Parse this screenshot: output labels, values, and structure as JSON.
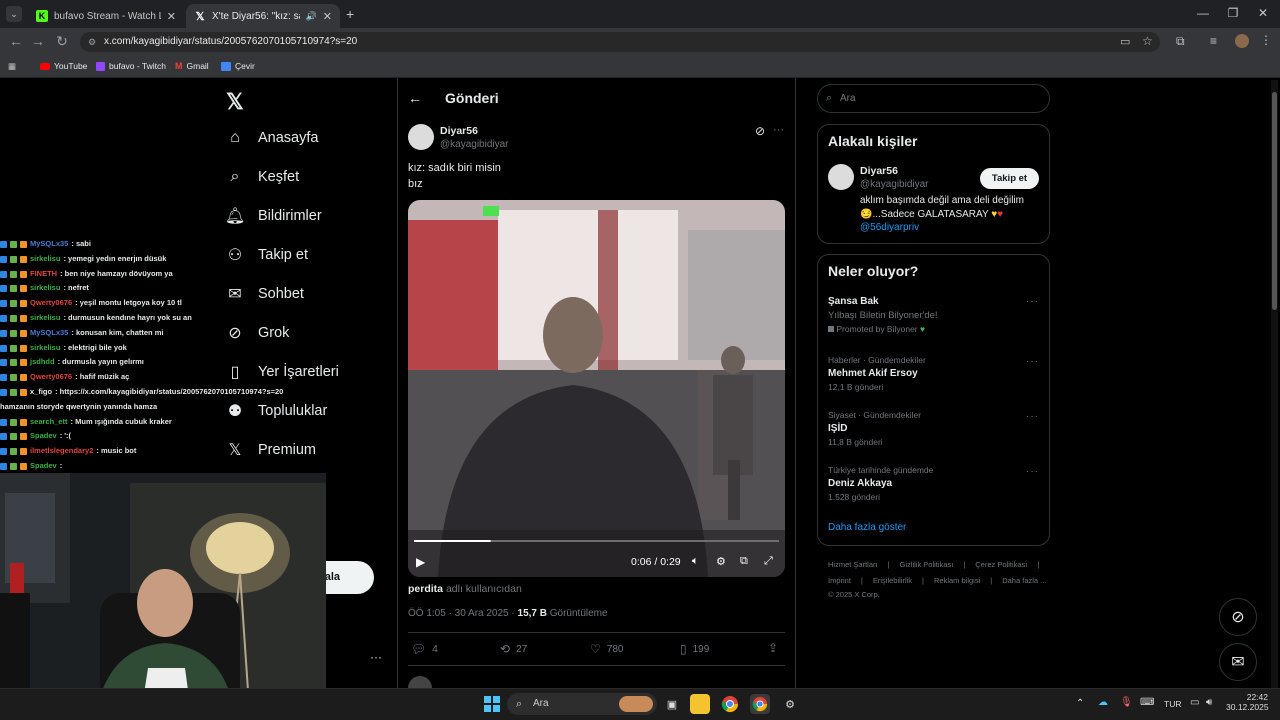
{
  "tabs": [
    {
      "title": "bufavo Stream - Watch Live on",
      "favicon": "kick-icon"
    },
    {
      "title": "X'te Diyar56: \"kız: sadık biri",
      "favicon": "x-icon"
    }
  ],
  "address": {
    "url": "x.com/kayagibidiyar/status/2005762070105710974?s=20"
  },
  "bookmarks": [
    {
      "label": "YouTube"
    },
    {
      "label": "bufavo - Twitch"
    },
    {
      "label": "Gmail"
    },
    {
      "label": "Çevir"
    }
  ],
  "nav": {
    "items": [
      {
        "label": "Anasayfa"
      },
      {
        "label": "Keşfet"
      },
      {
        "label": "Bildirimler"
      },
      {
        "label": "Takip et"
      },
      {
        "label": "Sohbet"
      },
      {
        "label": "Grok"
      },
      {
        "label": "Yer İşaretleri"
      },
      {
        "label": "Topluluklar"
      },
      {
        "label": "Premium"
      }
    ],
    "post_button_partial": "ala",
    "more": "···"
  },
  "post": {
    "header": "Gönderi",
    "author_name": "Diyar56",
    "author_handle": "@kayagibidiyar",
    "text_line1": "kız: sadık biri misin",
    "text_line2": "bız",
    "video_time": "0:06 / 0:29",
    "video_progress": 0.21,
    "caption_user": "perdita",
    "caption_suffix": "adlı kullanıcıdan",
    "time": "ÖÖ 1:05 · 30 Ara 2025 ·",
    "views_count": "15,7 B",
    "views_label": "Görüntüleme",
    "replies": "4",
    "reposts": "27",
    "likes": "780",
    "bookmarks": "199"
  },
  "chat": [
    {
      "user": "MySQLx35",
      "msg": ": sabi",
      "color": "#4a7bd1"
    },
    {
      "user": "sirkelisu",
      "msg": ": yemegi yedın enerjın düsük",
      "color": "#3cb043"
    },
    {
      "user": "FINETH",
      "msg": ": ben niye hamzayı dövüyom ya",
      "color": "#e0453b"
    },
    {
      "user": "sirkelisu",
      "msg": ": nefret",
      "color": "#3cb043"
    },
    {
      "user": "Qwerty0676",
      "msg": ": yeşil montu letgoya koy 10 tl",
      "color": "#e0453b"
    },
    {
      "user": "sirkelisu",
      "msg": ": durmusun kendıne hayrı yok su an",
      "color": "#3cb043"
    },
    {
      "user": "MySQLx35",
      "msg": ": konusan kim, chatten mi",
      "color": "#4a7bd1"
    },
    {
      "user": "sirkelisu",
      "msg": ": elektrigi bile yok",
      "color": "#3cb043"
    },
    {
      "user": "jsdhdd",
      "msg": ": durmusla yayın gelırmı",
      "color": "#3cb043"
    },
    {
      "user": "Qwerty0676",
      "msg": ": hafif müzik aç",
      "color": "#e0453b"
    },
    {
      "user": "x_figo",
      "msg": ": https://x.com/kayagibidiyar/status/2005762070105710974?s=20",
      "color": "#e7e9ea"
    },
    {
      "user": "",
      "msg": "hamzanın storyde qwertynin yanında hamza",
      "color": "#e7e9ea"
    },
    {
      "user": "search_ett",
      "msg": ": Mum ışığında cubuk kraker",
      "color": "#3cb043"
    },
    {
      "user": "Spadev",
      "msg": ": ':(",
      "color": "#3cb043"
    },
    {
      "user": "ilmetlslegendary2",
      "msg": ": music bot",
      "color": "#e0453b"
    },
    {
      "user": "Spadev",
      "msg": ":",
      "color": "#3cb043"
    }
  ],
  "right": {
    "search_placeholder": "Ara",
    "people_title": "Alakalı kişiler",
    "person_name": "Diyar56",
    "person_handle": "@kayagibidiyar",
    "follow_label": "Takip et",
    "bio_line1": "aklım başımda değil ama deli değilim",
    "bio_line2": "...Sadece GALATASARAY",
    "bio_link": "@56diyarpriv",
    "trends_title": "Neler oluyor?",
    "trends": [
      {
        "meta": "",
        "title": "Şansa Bak",
        "sub": "Yılbaşı Biletin Bilyoner'de!",
        "promo": "Promoted by Bilyoner"
      },
      {
        "meta": "Haberler · Gündemdekiler",
        "title": "Mehmet Akif Ersoy",
        "sub": "12,1 B gönderi",
        "promo": ""
      },
      {
        "meta": "Siyaset · Gündemdekiler",
        "title": "IŞİD",
        "sub": "11,8 B gönderi",
        "promo": ""
      },
      {
        "meta": "Türkiye tarihinde gündemde",
        "title": "Deniz Akkaya",
        "sub": "1.528 gönderi",
        "promo": ""
      }
    ],
    "show_more": "Daha fazla göster",
    "footer_line1": [
      "Hizmet Şartları",
      "Gizlilik Politikası",
      "Çerez Politikası"
    ],
    "footer_line2": [
      "İmprint",
      "Erişilebilirlik",
      "Reklam bilgisi",
      "Daha fazla ..."
    ],
    "copyright": "© 2025 X Corp."
  },
  "taskbar": {
    "search": "Ara",
    "lang": "TUR",
    "time": "22:42",
    "date": "30.12.2025"
  },
  "colors": {
    "accent": "#1d9bf0",
    "bg": "#000000",
    "border": "#2f3336"
  }
}
